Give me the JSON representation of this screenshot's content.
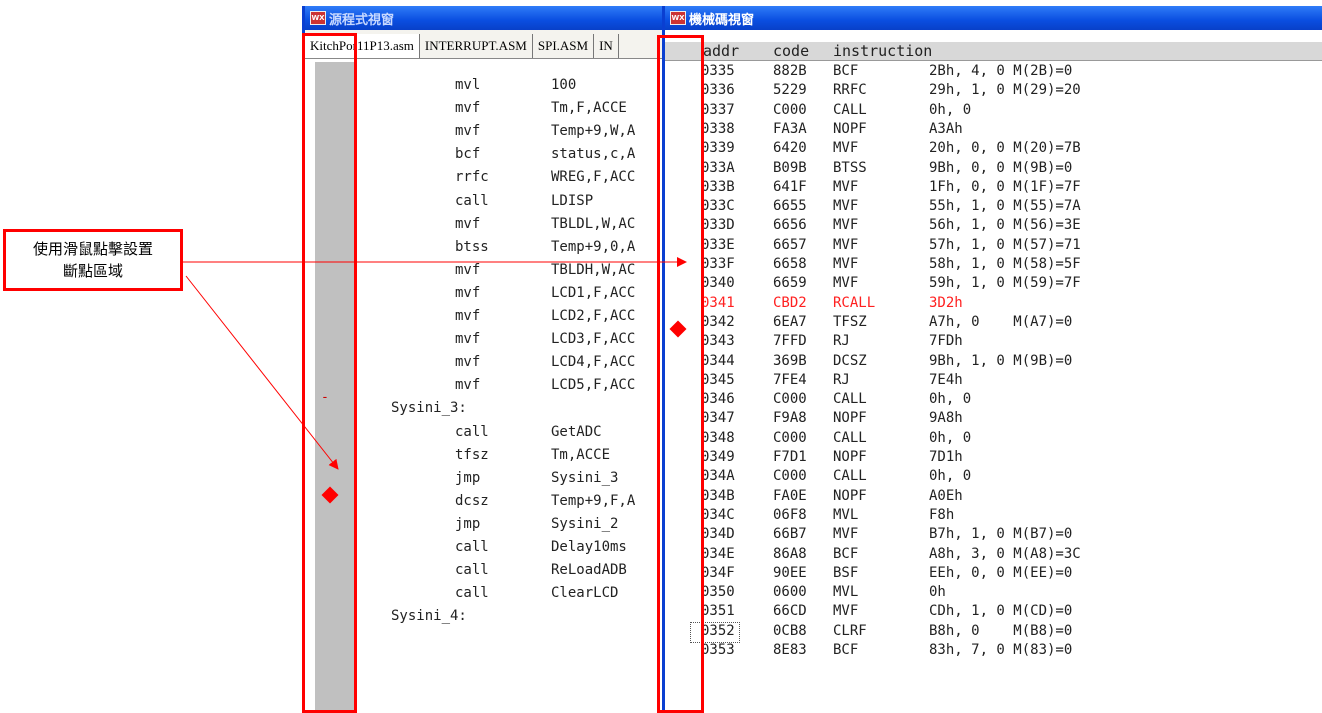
{
  "source_window": {
    "title": "源程式視窗",
    "tabs": [
      "KitchPor11P13.asm",
      "INTERRUPT.ASM",
      "SPI.ASM",
      "IN"
    ],
    "lines": [
      {
        "op": "mvl",
        "arg": "100"
      },
      {
        "op": "mvf",
        "arg": "Tm,F,ACCE"
      },
      {
        "op": "mvf",
        "arg": "Temp+9,W,A"
      },
      {
        "op": "bcf",
        "arg": "status,c,A"
      },
      {
        "op": "rrfc",
        "arg": "WREG,F,ACC"
      },
      {
        "op": "call",
        "arg": "LDISP"
      },
      {
        "op": "mvf",
        "arg": "TBLDL,W,AC"
      },
      {
        "op": "btss",
        "arg": "Temp+9,0,A"
      },
      {
        "op": "mvf",
        "arg": "TBLDH,W,AC"
      },
      {
        "op": "mvf",
        "arg": "LCD1,F,ACC"
      },
      {
        "op": "mvf",
        "arg": "LCD2,F,ACC"
      },
      {
        "op": "mvf",
        "arg": "LCD3,F,ACC"
      },
      {
        "op": "mvf",
        "arg": "LCD4,F,ACC"
      },
      {
        "op": "mvf",
        "arg": "LCD5,F,ACC"
      },
      {
        "label": "Sysini_3:"
      },
      {
        "op": "call",
        "arg": "GetADC"
      },
      {
        "op": "tfsz",
        "arg": "Tm,ACCE"
      },
      {
        "op": "jmp",
        "arg": "Sysini_3"
      },
      {
        "op": "dcsz",
        "arg": "Temp+9,F,A"
      },
      {
        "op": "jmp",
        "arg": "Sysini_2"
      },
      {
        "op": "call",
        "arg": "Delay10ms"
      },
      {
        "op": "call",
        "arg": "ReLoadADB"
      },
      {
        "op": "call",
        "arg": "ClearLCD"
      },
      {
        "label": "Sysini_4:"
      }
    ],
    "gutter_marker": "-"
  },
  "machine_window": {
    "title": "機械碼視窗",
    "header": {
      "addr": "addr",
      "code": "code",
      "instruction": "instruction"
    },
    "rows": [
      {
        "addr": "0335",
        "code": "882B",
        "ins": "BCF",
        "op": "2Bh, 4, 0 M(2B)=0"
      },
      {
        "addr": "0336",
        "code": "5229",
        "ins": "RRFC",
        "op": "29h, 1, 0 M(29)=20"
      },
      {
        "addr": "0337",
        "code": "C000",
        "ins": "CALL",
        "op": "0h, 0"
      },
      {
        "addr": "0338",
        "code": "FA3A",
        "ins": "NOPF",
        "op": "A3Ah"
      },
      {
        "addr": "0339",
        "code": "6420",
        "ins": "MVF",
        "op": "20h, 0, 0 M(20)=7B"
      },
      {
        "addr": "033A",
        "code": "B09B",
        "ins": "BTSS",
        "op": "9Bh, 0, 0 M(9B)=0"
      },
      {
        "addr": "033B",
        "code": "641F",
        "ins": "MVF",
        "op": "1Fh, 0, 0 M(1F)=7F"
      },
      {
        "addr": "033C",
        "code": "6655",
        "ins": "MVF",
        "op": "55h, 1, 0 M(55)=7A"
      },
      {
        "addr": "033D",
        "code": "6656",
        "ins": "MVF",
        "op": "56h, 1, 0 M(56)=3E"
      },
      {
        "addr": "033E",
        "code": "6657",
        "ins": "MVF",
        "op": "57h, 1, 0 M(57)=71"
      },
      {
        "addr": "033F",
        "code": "6658",
        "ins": "MVF",
        "op": "58h, 1, 0 M(58)=5F"
      },
      {
        "addr": "0340",
        "code": "6659",
        "ins": "MVF",
        "op": "59h, 1, 0 M(59)=7F"
      },
      {
        "addr": "0341",
        "code": "CBD2",
        "ins": "RCALL",
        "op": "3D2h",
        "breakpoint": true
      },
      {
        "addr": "0342",
        "code": "6EA7",
        "ins": "TFSZ",
        "op": "A7h, 0    M(A7)=0"
      },
      {
        "addr": "0343",
        "code": "7FFD",
        "ins": "RJ",
        "op": "7FDh"
      },
      {
        "addr": "0344",
        "code": "369B",
        "ins": "DCSZ",
        "op": "9Bh, 1, 0 M(9B)=0"
      },
      {
        "addr": "0345",
        "code": "7FE4",
        "ins": "RJ",
        "op": "7E4h"
      },
      {
        "addr": "0346",
        "code": "C000",
        "ins": "CALL",
        "op": "0h, 0"
      },
      {
        "addr": "0347",
        "code": "F9A8",
        "ins": "NOPF",
        "op": "9A8h"
      },
      {
        "addr": "0348",
        "code": "C000",
        "ins": "CALL",
        "op": "0h, 0"
      },
      {
        "addr": "0349",
        "code": "F7D1",
        "ins": "NOPF",
        "op": "7D1h"
      },
      {
        "addr": "034A",
        "code": "C000",
        "ins": "CALL",
        "op": "0h, 0"
      },
      {
        "addr": "034B",
        "code": "FA0E",
        "ins": "NOPF",
        "op": "A0Eh"
      },
      {
        "addr": "034C",
        "code": "06F8",
        "ins": "MVL",
        "op": "F8h"
      },
      {
        "addr": "034D",
        "code": "66B7",
        "ins": "MVF",
        "op": "B7h, 1, 0 M(B7)=0"
      },
      {
        "addr": "034E",
        "code": "86A8",
        "ins": "BCF",
        "op": "A8h, 3, 0 M(A8)=3C"
      },
      {
        "addr": "034F",
        "code": "90EE",
        "ins": "BSF",
        "op": "EEh, 0, 0 M(EE)=0"
      },
      {
        "addr": "0350",
        "code": "0600",
        "ins": "MVL",
        "op": "0h"
      },
      {
        "addr": "0351",
        "code": "66CD",
        "ins": "MVF",
        "op": "CDh, 1, 0 M(CD)=0"
      },
      {
        "addr": "0352",
        "code": "0CB8",
        "ins": "CLRF",
        "op": "B8h, 0    M(B8)=0",
        "focused": true
      },
      {
        "addr": "0353",
        "code": "8E83",
        "ins": "BCF",
        "op": "83h, 7, 0 M(83)=0"
      }
    ]
  },
  "callout": {
    "line1": "使用滑鼠點擊設置",
    "line2": "斷點區域"
  },
  "colors": {
    "highlight": "#ff0000",
    "titlebar": "#0a4ee0",
    "gutter": "#c0c0c0"
  }
}
